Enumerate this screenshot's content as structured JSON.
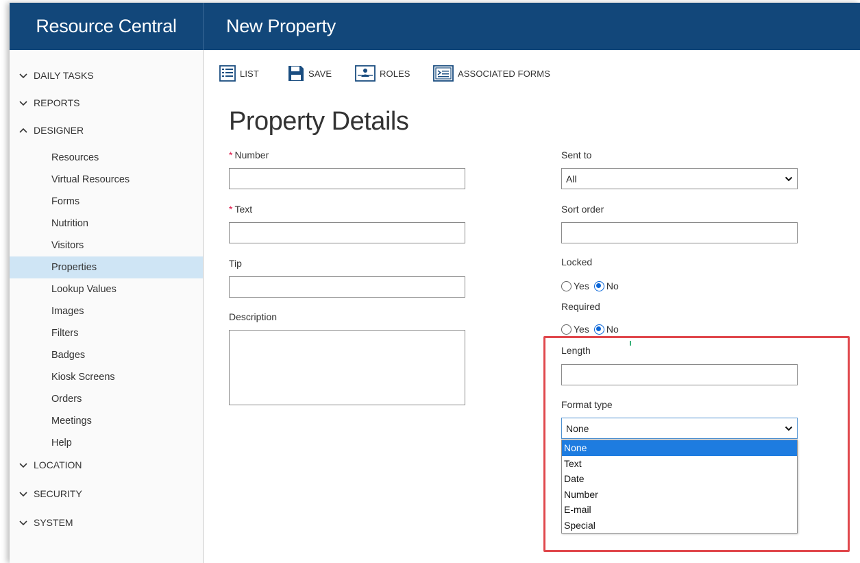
{
  "header": {
    "app_title": "Resource Central",
    "page_title": "New Property"
  },
  "sidebar": {
    "sections": [
      {
        "label": "DAILY TASKS",
        "expanded": false,
        "icon": "chevron-down-icon"
      },
      {
        "label": "REPORTS",
        "expanded": false,
        "icon": "chevron-down-icon"
      },
      {
        "label": "DESIGNER",
        "expanded": true,
        "icon": "chevron-up-icon"
      },
      {
        "label": "LOCATION",
        "expanded": false,
        "icon": "chevron-down-icon"
      },
      {
        "label": "SECURITY",
        "expanded": false,
        "icon": "chevron-down-icon"
      },
      {
        "label": "SYSTEM",
        "expanded": false,
        "icon": "chevron-down-icon"
      }
    ],
    "designer_items": [
      {
        "label": "Resources"
      },
      {
        "label": "Virtual Resources"
      },
      {
        "label": "Forms"
      },
      {
        "label": "Nutrition"
      },
      {
        "label": "Visitors"
      },
      {
        "label": "Properties",
        "active": true
      },
      {
        "label": "Lookup Values"
      },
      {
        "label": "Images"
      },
      {
        "label": "Filters"
      },
      {
        "label": "Badges"
      },
      {
        "label": "Kiosk Screens"
      },
      {
        "label": "Orders"
      },
      {
        "label": "Meetings"
      },
      {
        "label": "Help"
      }
    ]
  },
  "toolbar": {
    "list_label": "LIST",
    "save_label": "SAVE",
    "roles_label": "ROLES",
    "associated_forms_label": "ASSOCIATED FORMS"
  },
  "form": {
    "heading": "Property Details",
    "required_marker": "*",
    "number_label": "Number",
    "number_value": "",
    "text_label": "Text",
    "text_value": "",
    "tip_label": "Tip",
    "tip_value": "",
    "description_label": "Description",
    "description_value": "",
    "sent_to_label": "Sent to",
    "sent_to_value": "All",
    "sort_order_label": "Sort order",
    "sort_order_value": "",
    "locked_label": "Locked",
    "locked_value": "No",
    "required_label": "Required",
    "required_value": "No",
    "yes_label": "Yes",
    "no_label": "No",
    "length_label": "Length",
    "length_value": "",
    "format_type_label": "Format type",
    "format_type_value": "None",
    "format_type_options": [
      "None",
      "Text",
      "Date",
      "Number",
      "E-mail",
      "Special"
    ]
  },
  "colors": {
    "header_bg": "#12477a",
    "active_nav_bg": "#cfe5f5",
    "radio_accent": "#0a66d8",
    "option_highlight": "#1e7ce0",
    "annotation_box": "#e0484d",
    "required_marker": "#dd1144"
  }
}
